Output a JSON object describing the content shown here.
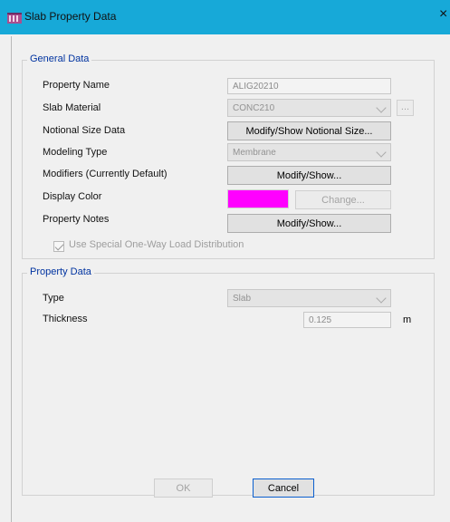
{
  "window": {
    "title": "Slab Property Data",
    "close_glyph": "×"
  },
  "general": {
    "legend": "General Data",
    "property_name_label": "Property Name",
    "property_name_value": "ALIG20210",
    "slab_material_label": "Slab Material",
    "slab_material_value": "CONC210",
    "slab_material_button": "...",
    "notional_size_label": "Notional Size Data",
    "notional_size_button": "Modify/Show Notional Size...",
    "modeling_type_label": "Modeling Type",
    "modeling_type_value": "Membrane",
    "modifiers_label": "Modifiers (Currently Default)",
    "modifiers_button": "Modify/Show...",
    "display_color_label": "Display Color",
    "display_color_value": "#ff00ff",
    "change_button": "Change...",
    "property_notes_label": "Property Notes",
    "property_notes_button": "Modify/Show...",
    "special_load_label": "Use Special One-Way Load Distribution"
  },
  "property_data": {
    "legend": "Property Data",
    "type_label": "Type",
    "type_value": "Slab",
    "thickness_label": "Thickness",
    "thickness_value": "0.125",
    "thickness_unit": "m"
  },
  "footer": {
    "ok_button": "OK",
    "cancel_button": "Cancel"
  }
}
